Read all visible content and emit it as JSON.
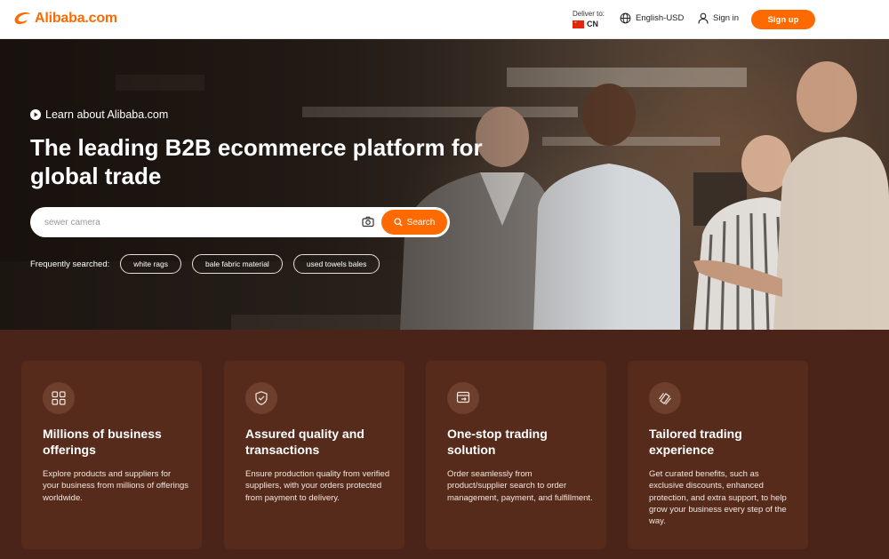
{
  "header": {
    "logo_text": "Alibaba.com",
    "deliver_label": "Deliver to:",
    "deliver_country": "CN",
    "language": "English-USD",
    "sign_in": "Sign in",
    "sign_up": "Sign up"
  },
  "hero": {
    "learn_link": "Learn about Alibaba.com",
    "headline": "The leading B2B ecommerce platform for global trade",
    "search_placeholder": "sewer camera",
    "search_button": "Search",
    "frequently_label": "Frequently searched:",
    "chips": [
      "white rags",
      "bale fabric material",
      "used towels bales"
    ]
  },
  "features": [
    {
      "icon": "grid-icon",
      "title": "Millions of business offerings",
      "desc": "Explore products and suppliers for your business from millions of offerings worldwide."
    },
    {
      "icon": "shield-check-icon",
      "title": "Assured quality and transactions",
      "desc": "Ensure production quality from verified suppliers, with your orders protected from payment to delivery."
    },
    {
      "icon": "invoice-icon",
      "title": "One-stop trading solution",
      "desc": "Order seamlessly from product/supplier search to order management, payment, and fulfillment."
    },
    {
      "icon": "cards-icon",
      "title": "Tailored trading experience",
      "desc": "Get curated benefits, such as exclusive discounts, enhanced protection, and extra support, to help grow your business every step of the way."
    }
  ],
  "colors": {
    "brand": "#ff6a00",
    "feature_bg": "#4a2418",
    "card_bg": "#572b1b"
  }
}
